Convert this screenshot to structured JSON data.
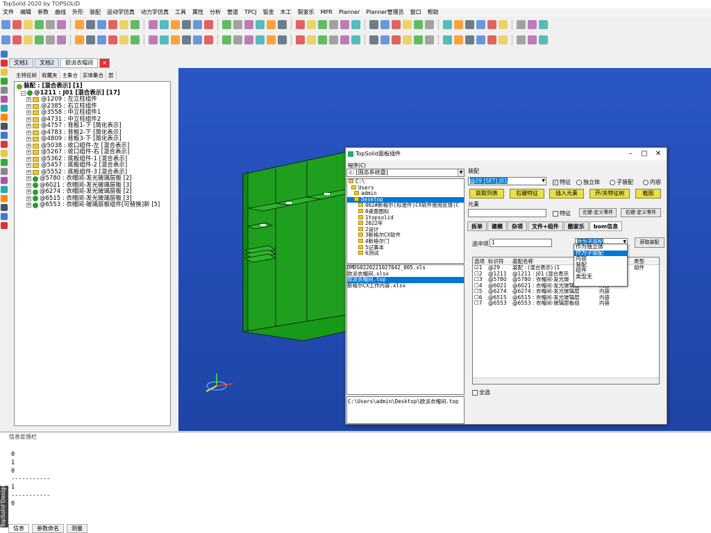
{
  "window": {
    "title": "TopSolid 2020 by TOPSOLID"
  },
  "menu": [
    "文件",
    "编辑",
    "参数",
    "曲线",
    "外形",
    "装配",
    "运动学仿真",
    "动力学仿真",
    "工具",
    "属性",
    "分析",
    "管道",
    "TPCJ",
    "钣金",
    "木工",
    "裂家乐",
    "MPR",
    "Planner",
    "Planner管理员",
    "窗口",
    "帮助"
  ],
  "doc_tabs": [
    "文档1",
    "文档2",
    "欧派衣帽间"
  ],
  "side_tabs": [
    "主特征树",
    "收藏夹",
    "主集合",
    "实体集合",
    "层"
  ],
  "tree": {
    "root": "装配 : [混合表示] [1]",
    "top": "@1211 : J01 [混合表示] [17]",
    "items": [
      "@1209 : 左立柱组件",
      "@2385 : 右立柱组件",
      "@3558 : 中立柱组件1",
      "@4731 : 中立柱组件2",
      "@4757 : 背板1-下 [简化表示]",
      "@4783 : 背板2-下 [简化表示]",
      "@4809 : 背板3-下 [简化表示]",
      "@5038 : 收口组件-左 [混合表示]",
      "@5267 : 收口组件-右 [混合表示]",
      "@5362 : 底板组件-1 [混合表示]",
      "@5457 : 底板组件-2 [混合表示]",
      "@5552 : 底板组件-3 [混合表示]",
      "@5780 : 衣帽间-发光玻璃层板 [2]",
      "@6021 : 衣帽间-发光玻璃层板 [3]",
      "@6274 : 衣帽间-发光玻璃层板 [2]",
      "@6515 : 衣帽间-发光玻璃层板 [3]",
      "@6553 : 衣帽间-玻璃层板组件[可替换]新 [5]"
    ]
  },
  "info": {
    "title": "信息反馈栏",
    "lines": [
      "0",
      "1",
      "0",
      "-----------",
      "1",
      "-----------",
      "0"
    ],
    "tabs": [
      "信息",
      "参数命名",
      "测量"
    ],
    "vertical_label": "TopSolid'Design"
  },
  "dialog": {
    "title": "TopSolid面板插件",
    "menu": "程序(C)",
    "drive": "c: [固态系统盘]",
    "dirs": [
      "C:\\",
      "Users",
      "admin",
      "Desktop",
      "002#新格尔(标准件)CX软件使用反馈(C",
      "0桌面图标",
      "1topsolid",
      "2022年",
      "2设计",
      "3新格尔CX软件",
      "4新格尔门",
      "5记事本",
      "6测试"
    ],
    "files": [
      "DMDS0220221027042_005.xls",
      "欧派衣帽间.xlsx",
      "欧派衣帽间.top",
      "新格尔CX工作内容.xlsx"
    ],
    "path": "C:\\Users\\admin\\Desktop\\欧派衣帽间.top",
    "assembly_label": "装配",
    "assembly_value": "@29 [SET] J01",
    "chk_feature": "特征",
    "radio_independent": "独立体",
    "radio_sub": "子装配",
    "radio_content": "内容",
    "buttons": [
      "获取列表",
      "右键特征",
      "插入元素",
      "开/关特征树",
      "截图"
    ],
    "element_label": "元素",
    "element_feature": "特征",
    "left_custom": "左键-定义零件",
    "right_custom": "右键-定义零件",
    "panel_tabs": [
      "拆单",
      "建模",
      "杂项",
      "文件+组件",
      "酷家乐",
      "bom信息"
    ],
    "selected_label": "选中项",
    "selected_value": "1",
    "type_combo": "作为子装配",
    "get_asm": "获取装配",
    "dropdown_options": [
      "作为独立体",
      "作为子装配",
      "内容",
      "装配",
      "组件",
      "类型无"
    ],
    "table_headers": [
      "选项",
      "标识符",
      "装配名称",
      "",
      "类型"
    ],
    "rows": [
      {
        "chk": "☑",
        "n": "1",
        "id": "@29",
        "name": "装配 : (混合表示) (1",
        "t1": "",
        "t2": "组件"
      },
      {
        "chk": "☐",
        "n": "2",
        "id": "@1211",
        "name": "@1211 : J01 (混合表示",
        "t1": "",
        "t2": ""
      },
      {
        "chk": "☐",
        "n": "3",
        "id": "@5780",
        "name": "@5780 : 衣帽间-发光玻",
        "t1": "",
        "t2": ""
      },
      {
        "chk": "☐",
        "n": "4",
        "id": "@6021",
        "name": "@6021 : 衣帽间-发光玻璃层",
        "t1": "内容",
        "t2": ""
      },
      {
        "chk": "☐",
        "n": "5",
        "id": "@6274",
        "name": "@6274 : 衣帽间-发光玻璃层",
        "t1": "内容",
        "t2": ""
      },
      {
        "chk": "☐",
        "n": "6",
        "id": "@6515",
        "name": "@6515 : 衣帽间-发光玻璃层",
        "t1": "内容",
        "t2": ""
      },
      {
        "chk": "☐",
        "n": "7",
        "id": "@6553",
        "name": "@6553 : 衣帽间-玻璃层板组",
        "t1": "内容",
        "t2": ""
      }
    ],
    "select_all": "全选"
  },
  "colors": {
    "viewport": "#2a56c4",
    "cabinet": "#1e9e1e",
    "selection": "#0078d7",
    "yellow_button": "#e8e04a"
  }
}
